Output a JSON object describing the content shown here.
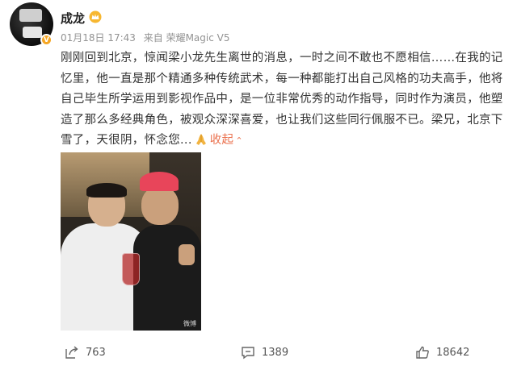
{
  "post": {
    "author": "成龙",
    "date": "01月18日 17:43",
    "source": "来自 荣耀Magic V5",
    "content": "刚刚回到北京，惊闻梁小龙先生离世的消息，一时之间不敢也不愿相信……在我的记忆里，他一直是那个精通多种传统武术，每一种都能打出自己风格的功夫高手，他将自己毕生所学运用到影视作品中，是一位非常优秀的动作指导，同时作为演员，他塑造了那么多经典角色，被观众深深喜爱，也让我们这些同行佩服不已。梁兄，北京下雪了，天很阴，怀念您...",
    "collapse_label": "收起",
    "verified_badge": "V",
    "photo_watermark": "微博",
    "colors": {
      "link": "#eb7350",
      "badge": "#f5a623",
      "meta": "#939393"
    }
  },
  "actions": {
    "share_count": "763",
    "comment_count": "1389",
    "like_count": "18642"
  }
}
